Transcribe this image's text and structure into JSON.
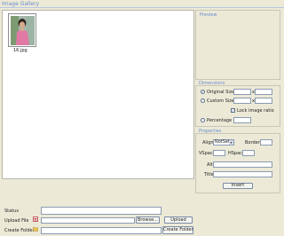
{
  "header": {
    "title": "Image Gallery"
  },
  "gallery": {
    "items": [
      {
        "filename": "16.jpg"
      }
    ]
  },
  "preview": {
    "title": "Preview"
  },
  "dimensions": {
    "title": "Dimensions",
    "original_label": "Original Size",
    "custom_label": "Custom Size",
    "lock_label": "Lock image ratio",
    "percentage_label": "Percentage",
    "times_sign": "x",
    "original_selected": true,
    "lock_checked": true
  },
  "properties": {
    "title": "Properties",
    "align_label": "Align",
    "align_value": "NotSet",
    "border_label": "Border",
    "vspace_label": "VSpace",
    "hspace_label": "HSpace",
    "alt_label": "Alt",
    "title_label": "Title"
  },
  "actions": {
    "insert_label": "Insert"
  },
  "bottom": {
    "status_label": "Status",
    "upload_label": "Upload File",
    "browse_label": "Browse...",
    "upload_button": "Upload",
    "create_folder_label": "Create Folder",
    "create_folder_button": "Create Folder"
  },
  "icons": {
    "upload": "upload-file-icon",
    "folder": "folder-icon"
  },
  "colors": {
    "accent": "#6a8bd0",
    "panel_bg": "#ecead7",
    "field_border": "#8c9bb2"
  }
}
